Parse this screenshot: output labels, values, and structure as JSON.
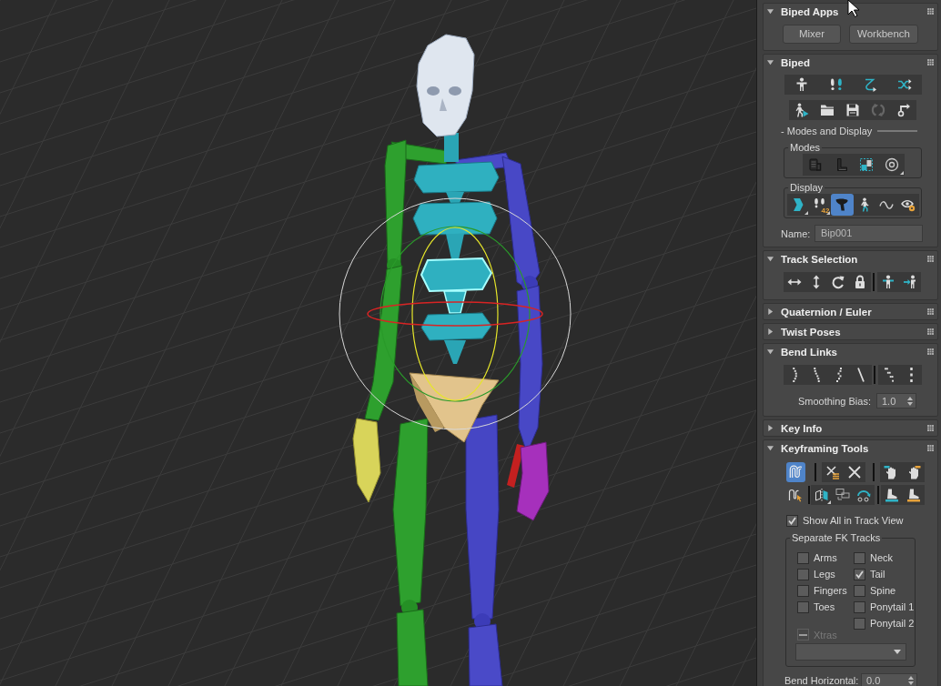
{
  "rollouts": [
    {
      "kind": "apps",
      "title": "Biped Apps",
      "expanded": true,
      "buttons": [
        "Mixer",
        "Workbench"
      ]
    },
    {
      "kind": "biped",
      "title": "Biped",
      "expanded": true,
      "file_tools": [
        {
          "disabled": false
        },
        {
          "disabled": false
        },
        {
          "disabled": false
        },
        {
          "disabled": true
        },
        {
          "disabled": false
        }
      ],
      "section": "- Modes and Display",
      "modes_label": "Modes",
      "display_label": "Display",
      "display_tools": [
        {
          "selected": false
        },
        {
          "selected": false,
          "badge": "42"
        },
        {
          "selected": true
        },
        {
          "selected": false
        },
        {
          "selected": false
        },
        {
          "selected": false
        }
      ],
      "name_label": "Name:",
      "name_value": "Bip001"
    },
    {
      "kind": "track",
      "title": "Track Selection",
      "expanded": true
    },
    {
      "title": "Quaternion / Euler",
      "expanded": false
    },
    {
      "title": "Twist Poses",
      "expanded": false
    },
    {
      "kind": "bend",
      "title": "Bend Links",
      "expanded": true,
      "bias_label": "Smoothing Bias:",
      "bias_value": "1.0"
    },
    {
      "title": "Key Info",
      "expanded": false
    },
    {
      "kind": "keyframing",
      "title": "Keyframing Tools",
      "expanded": true,
      "tools": [
        {
          "selected": true
        },
        {
          "selected": false
        },
        {
          "selected": false
        },
        {
          "selected": false
        },
        {
          "selected": false
        },
        {
          "selected": false
        },
        {
          "selected": false
        },
        {
          "selected": false
        },
        {
          "selected": false
        },
        {
          "selected": false
        },
        {
          "selected": false
        }
      ],
      "show_all": {
        "label": "Show All in Track View",
        "checked": true
      },
      "fk_label": "Separate FK Tracks",
      "fk_left": [
        {
          "label": "Arms",
          "checked": false
        },
        {
          "label": "Legs",
          "checked": false
        },
        {
          "label": "Fingers",
          "checked": false
        },
        {
          "label": "Toes",
          "checked": false
        }
      ],
      "fk_right": [
        {
          "label": "Neck",
          "checked": false
        },
        {
          "label": "Tail",
          "checked": true
        },
        {
          "label": "Spine",
          "checked": false
        },
        {
          "label": "Ponytail 1",
          "checked": false
        },
        {
          "label": "Ponytail 2",
          "checked": false
        }
      ],
      "xtras": {
        "label": "Xtras",
        "indeterminate": true,
        "disabled": true
      },
      "bend_label": "Bend Horizontal:",
      "bend_value": "0.0"
    }
  ]
}
